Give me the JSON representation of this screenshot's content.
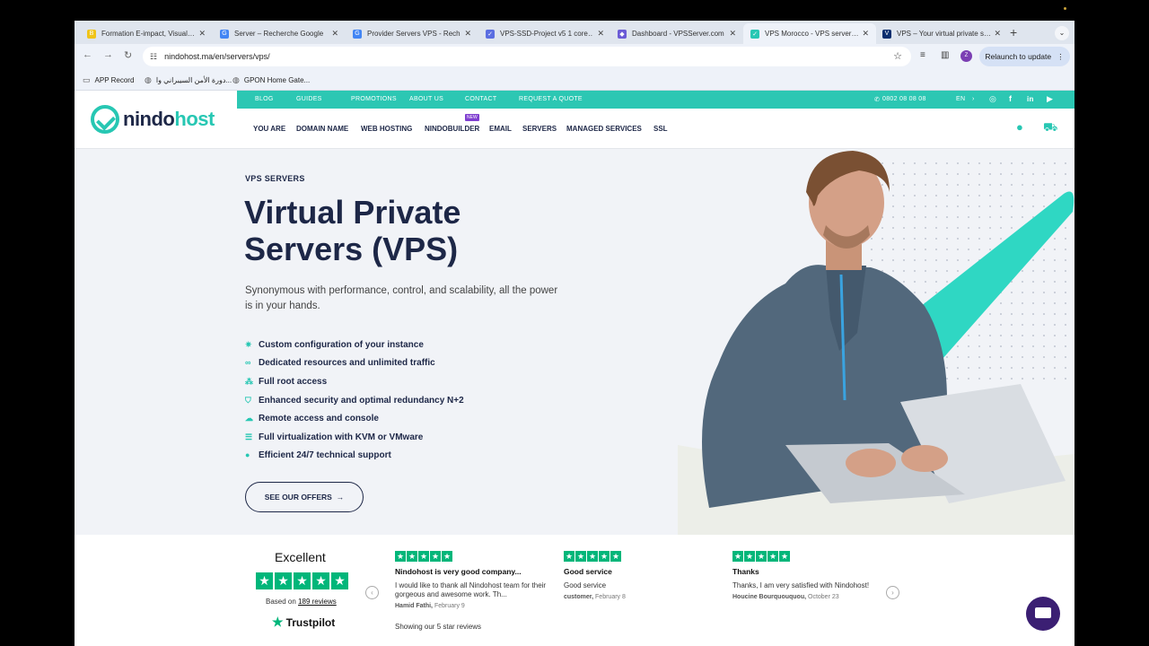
{
  "browser": {
    "tabs": [
      {
        "title": "Formation E-impact, Visual…",
        "fav_color": "#f0c419"
      },
      {
        "title": "Server – Recherche Google",
        "fav_color": "#4285f4"
      },
      {
        "title": "Provider Servers VPS - Rech…",
        "fav_color": "#4285f4"
      },
      {
        "title": "VPS-SSD-Project v5 1 core…",
        "fav_color": "#5b6ee1"
      },
      {
        "title": "Dashboard - VPSServer.com",
        "fav_color": "#6b5bd6"
      },
      {
        "title": "VPS Morocco - VPS server…",
        "fav_color": "#27c7b3"
      },
      {
        "title": "VPS – Your virtual private s…",
        "fav_color": "#0a2e6e"
      }
    ],
    "url": "nindohost.ma/en/servers/vps/",
    "relaunch": "Relaunch to update",
    "avatar_letter": "Z",
    "bookmarks": [
      "APP Record",
      "دورة الأمن السيبراني وا...",
      "GPON Home Gate..."
    ]
  },
  "site": {
    "logo_part1": "nindo",
    "logo_part2": "host",
    "topbar": {
      "links": [
        "BLOG",
        "GUIDES",
        "PROMOTIONS",
        "ABOUT US",
        "CONTACT",
        "REQUEST A QUOTE"
      ],
      "phone": "0802 08 08 08",
      "lang": "EN"
    },
    "nav": [
      "YOU ARE",
      "DOMAIN NAME",
      "WEB HOSTING",
      "NINDOBUILDER",
      "EMAIL",
      "SERVERS",
      "MANAGED SERVICES",
      "SSL"
    ],
    "new_badge": "NEW",
    "accent": "#2cc7b3",
    "navy": "#1d2747"
  },
  "hero": {
    "eyebrow": "VPS SERVERS",
    "title_line1": "Virtual Private",
    "title_line2": "Servers (VPS)",
    "description": "Synonymous with performance, control, and scalability, all the power is in your hands.",
    "features": [
      "Custom configuration of your instance",
      "Dedicated resources and unlimited traffic",
      "Full root access",
      "Enhanced security and optimal redundancy N+2",
      "Remote access and console",
      "Full virtualization with KVM or VMware",
      "Efficient 24/7 technical support"
    ],
    "cta": "SEE OUR OFFERS"
  },
  "reviews": {
    "rating_word": "Excellent",
    "based_prefix": "Based on",
    "based_count": "189 reviews",
    "brand": "Trustpilot",
    "showing": "Showing our 5 star reviews",
    "items": [
      {
        "title": "Nindohost is very good company...",
        "body": "I would like to thank all Nindohost team for their gorgeous and awesome work. Th...",
        "author": "Hamid Fathi,",
        "date": "February 9"
      },
      {
        "title": "Good service",
        "body": "Good service",
        "author": "customer,",
        "date": "February 8"
      },
      {
        "title": "Thanks",
        "body": "Thanks, I am very satisfied with Nindohost!",
        "author": "Houcine Bourquouquou,",
        "date": "October 23"
      }
    ]
  }
}
